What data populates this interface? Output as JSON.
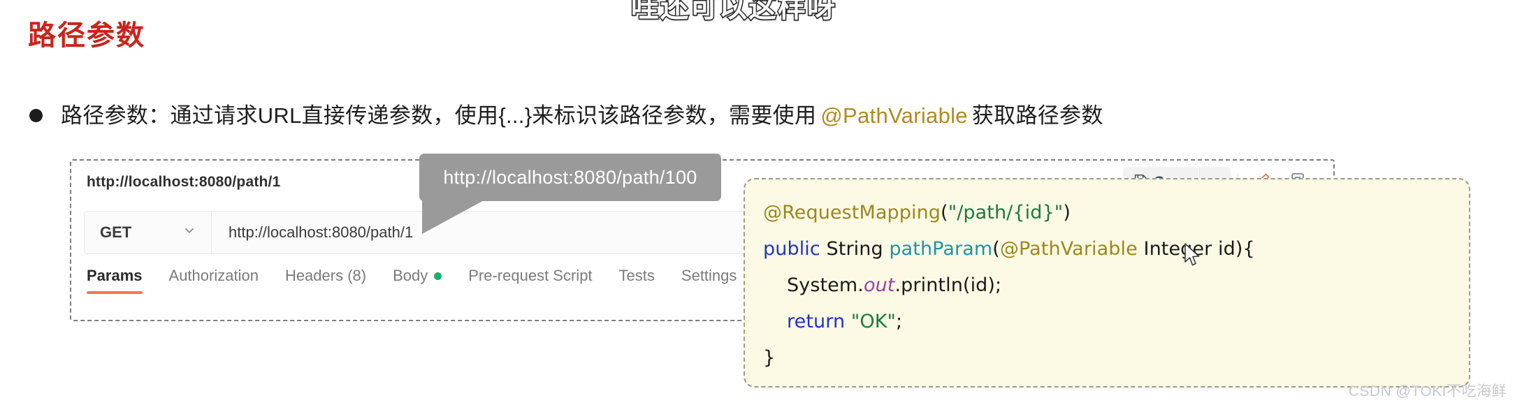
{
  "slide": {
    "top_caption": "哇还可以这样呀",
    "title": "路径参数",
    "title_color": "#c9241c",
    "bullet": {
      "part1": "路径参数：通过请求URL直接传递参数，使用{...}来标识该路径参数，需要使用",
      "accent": "@PathVariable",
      "accent_color": "#b08b1e",
      "part2": "获取路径参数"
    }
  },
  "callout": {
    "text": "http://localhost:8080/path/100",
    "bg_color": "#9a9a9a",
    "text_color": "#ffffff"
  },
  "postman": {
    "tab_name": "http://localhost:8080/path/1",
    "actions": {
      "save_label": "Save",
      "save_icon": "floppy-disk-icon",
      "caret_icon": "chevron-down-icon",
      "comment_icon": "pencil-icon",
      "docs_icon": "document-icon"
    },
    "request": {
      "method": "GET",
      "method_caret_icon": "chevron-down-icon",
      "url": "http://localhost:8080/path/1"
    },
    "tabs": [
      {
        "label": "Params",
        "active": true,
        "badge": ""
      },
      {
        "label": "Authorization",
        "active": false,
        "badge": ""
      },
      {
        "label": "Headers (8)",
        "active": false,
        "badge": ""
      },
      {
        "label": "Body",
        "active": false,
        "badge": "dot"
      },
      {
        "label": "Pre-request Script",
        "active": false,
        "badge": ""
      },
      {
        "label": "Tests",
        "active": false,
        "badge": ""
      },
      {
        "label": "Settings",
        "active": false,
        "badge": ""
      }
    ],
    "active_underline_color": "#ef7b45",
    "body_dot_color": "#17b26a"
  },
  "code": {
    "bg_color": "#fcfae4",
    "border_color": "#9b9b8d",
    "lines": [
      {
        "indent": false,
        "tokens": [
          {
            "t": "@RequestMapping",
            "c": "ann"
          },
          {
            "t": "(",
            "c": "plain"
          },
          {
            "t": "\"/path/{id}\"",
            "c": "str"
          },
          {
            "t": ")",
            "c": "plain"
          }
        ]
      },
      {
        "indent": false,
        "tokens": [
          {
            "t": "public",
            "c": "kw"
          },
          {
            "t": " String ",
            "c": "plain"
          },
          {
            "t": "pathParam",
            "c": "fn"
          },
          {
            "t": "(",
            "c": "plain"
          },
          {
            "t": "@PathVariable",
            "c": "ann"
          },
          {
            "t": " Integer id){",
            "c": "plain"
          }
        ]
      },
      {
        "indent": true,
        "tokens": [
          {
            "t": "System.",
            "c": "plain"
          },
          {
            "t": "out",
            "c": "static"
          },
          {
            "t": ".println(id);",
            "c": "plain"
          }
        ]
      },
      {
        "indent": true,
        "tokens": [
          {
            "t": "return",
            "c": "kw"
          },
          {
            "t": " ",
            "c": "plain"
          },
          {
            "t": "\"OK\"",
            "c": "str"
          },
          {
            "t": ";",
            "c": "plain"
          }
        ]
      },
      {
        "indent": false,
        "tokens": [
          {
            "t": "}",
            "c": "plain"
          }
        ]
      }
    ]
  },
  "watermark": "CSDN @TOKI不吃海鲜"
}
